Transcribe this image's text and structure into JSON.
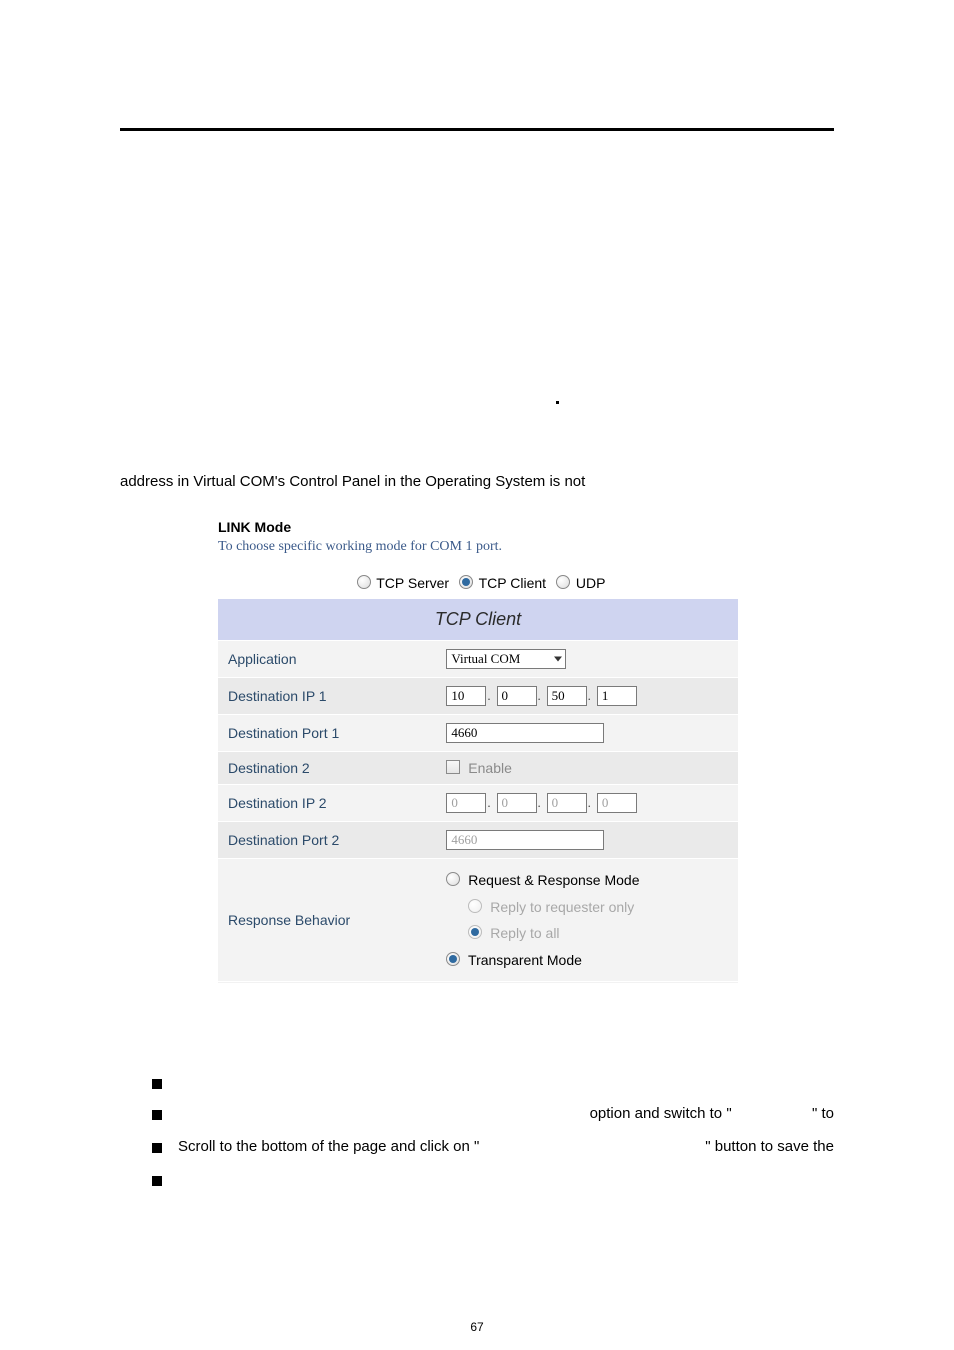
{
  "paragraph_line": "address in Virtual COM's Control Panel in the Operating System is not",
  "link_mode": {
    "title": "LINK Mode",
    "subtitle": "To choose specific working mode for COM 1 port.",
    "radios": {
      "tcp_server": "TCP Server",
      "tcp_client": "TCP Client",
      "udp": "UDP"
    },
    "panel_title": "TCP Client",
    "rows": {
      "application": {
        "label": "Application",
        "value": "Virtual COM"
      },
      "dest_ip1": {
        "label": "Destination IP 1",
        "octets": [
          "10",
          "0",
          "50",
          "1"
        ]
      },
      "dest_port1": {
        "label": "Destination Port 1",
        "value": "4660"
      },
      "dest2": {
        "label": "Destination 2",
        "checkbox_label": "Enable"
      },
      "dest_ip2": {
        "label": "Destination IP 2",
        "octets": [
          "0",
          "0",
          "0",
          "0"
        ]
      },
      "dest_port2": {
        "label": "Destination Port 2",
        "value": "4660"
      },
      "response": {
        "label": "Response Behavior",
        "opt1": "Request & Response Mode",
        "opt1a": "Reply to requester only",
        "opt1b": "Reply to all",
        "opt2": "Transparent Mode"
      }
    }
  },
  "bullets": {
    "b2_mid": "option and switch to \"",
    "b2_end": "\" to",
    "b3_a": "Scroll to the bottom of the page and click on \"",
    "b3_b": "\" button to save the"
  },
  "page_number": "67",
  "chart_data": null
}
